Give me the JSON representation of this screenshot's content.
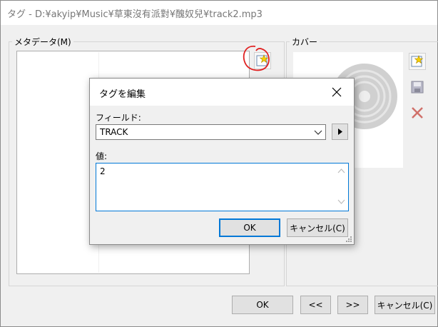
{
  "window": {
    "title": "タグ - D:¥akyip¥Music¥草東沒有派對¥醜奴兒¥track2.mp3"
  },
  "metadata_group": {
    "label": "メタデータ(M)"
  },
  "cover_group": {
    "label": "カバー"
  },
  "buttons": {
    "ok": "OK",
    "prev": "<<",
    "next": ">>",
    "cancel": "キャンセル(C)"
  },
  "dialog": {
    "title": "タグを編集",
    "field_label": "フィールド:",
    "field_value": "TRACK",
    "value_label": "値:",
    "value_text": "2",
    "ok": "OK",
    "cancel": "キャンセル(C)"
  },
  "colors": {
    "accent": "#0078d7",
    "annotation": "#e02020"
  }
}
